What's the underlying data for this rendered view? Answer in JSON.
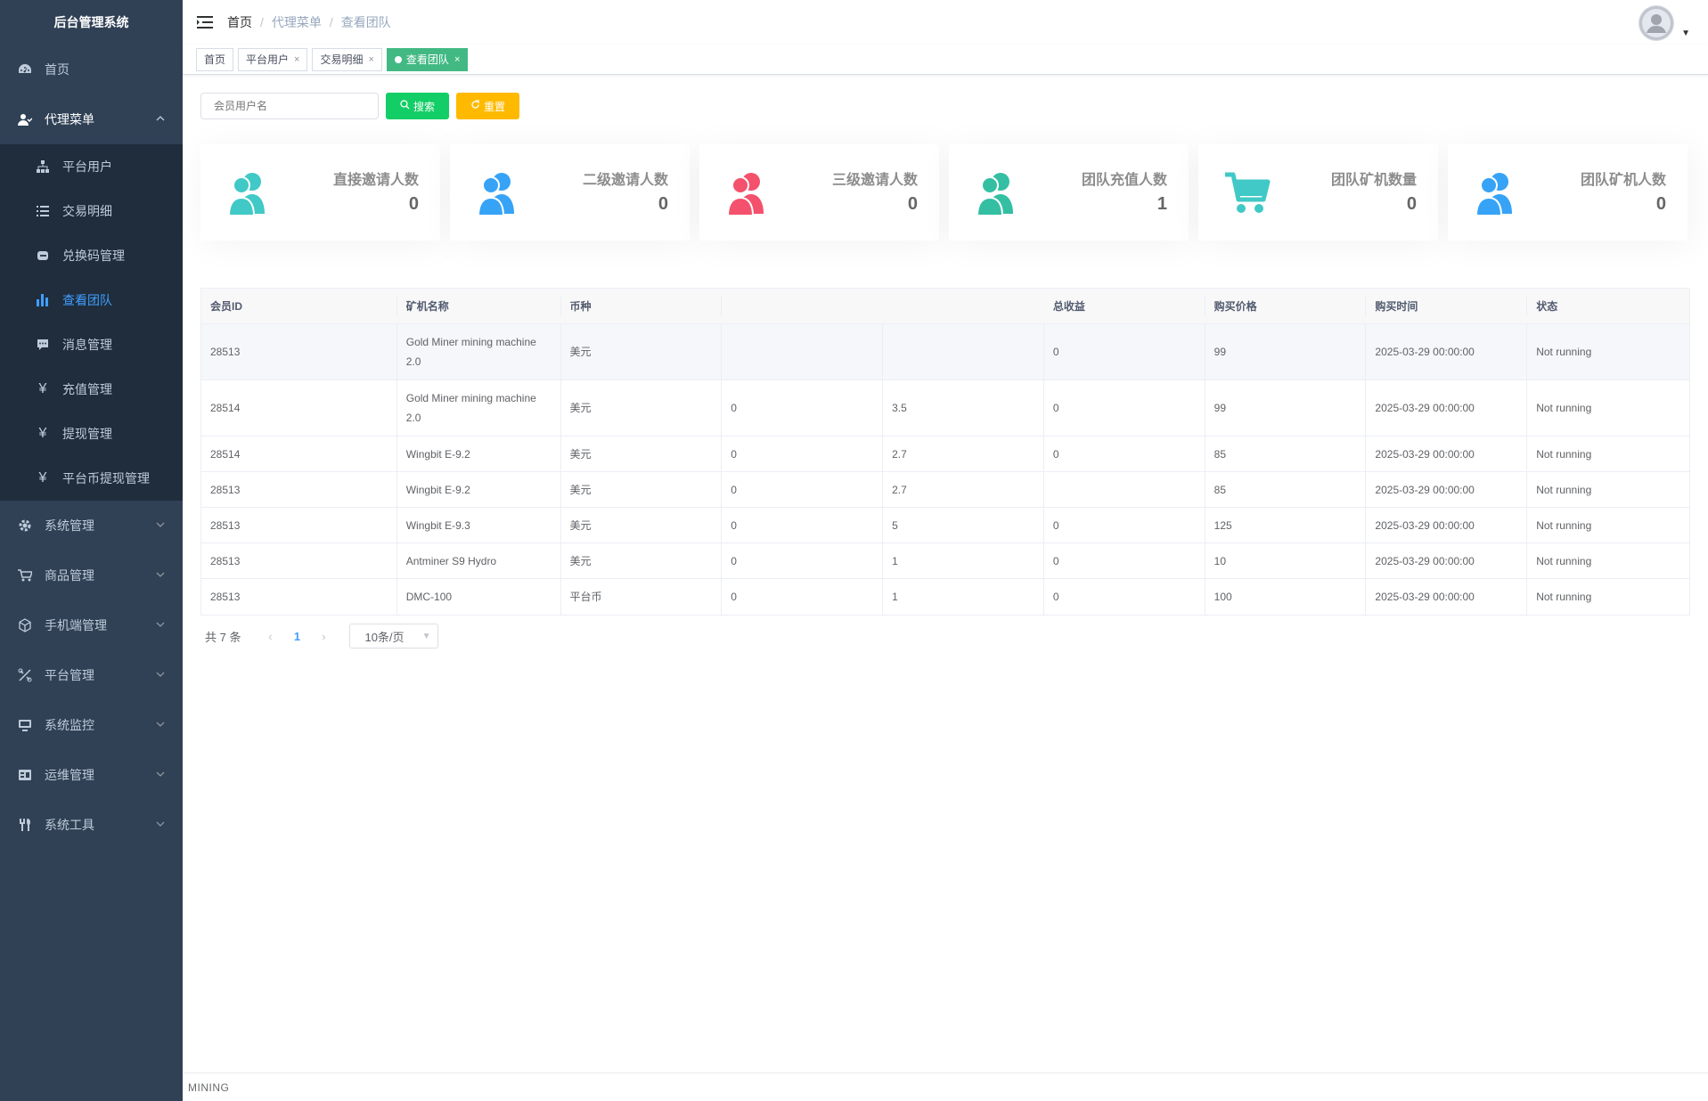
{
  "app": {
    "title": "后台管理系统"
  },
  "sidebar": {
    "items": [
      {
        "label": "首页",
        "icon": "dashboard-icon"
      },
      {
        "label": "代理菜单",
        "icon": "user-icon",
        "open": true
      },
      {
        "label": "系统管理",
        "icon": "gear-icon"
      },
      {
        "label": "商品管理",
        "icon": "cart-icon"
      },
      {
        "label": "手机端管理",
        "icon": "cube-icon"
      },
      {
        "label": "平台管理",
        "icon": "tools-icon"
      },
      {
        "label": "系统监控",
        "icon": "monitor-icon"
      },
      {
        "label": "运维管理",
        "icon": "server-icon"
      },
      {
        "label": "系统工具",
        "icon": "toolbox-icon"
      }
    ],
    "submenu": [
      {
        "label": "平台用户",
        "icon": "tree-icon"
      },
      {
        "label": "交易明细",
        "icon": "list-icon"
      },
      {
        "label": "兑换码管理",
        "icon": "code-icon"
      },
      {
        "label": "查看团队",
        "icon": "bar-chart-icon",
        "active": true
      },
      {
        "label": "消息管理",
        "icon": "message-icon"
      },
      {
        "label": "充值管理",
        "icon": "yen-icon"
      },
      {
        "label": "提现管理",
        "icon": "yen-icon"
      },
      {
        "label": "平台币提现管理",
        "icon": "yen-icon"
      }
    ]
  },
  "breadcrumb": [
    "首页",
    "代理菜单",
    "查看团队"
  ],
  "tags": [
    {
      "label": "首页",
      "closable": false
    },
    {
      "label": "平台用户",
      "closable": true
    },
    {
      "label": "交易明细",
      "closable": true
    },
    {
      "label": "查看团队",
      "closable": true,
      "active": true
    }
  ],
  "search": {
    "placeholder": "会员用户名",
    "search_label": "搜索",
    "reset_label": "重置"
  },
  "cards": [
    {
      "title": "直接邀请人数",
      "value": "0",
      "icon": "people-icon",
      "color": "#40c9c6"
    },
    {
      "title": "二级邀请人数",
      "value": "0",
      "icon": "people-icon",
      "color": "#36a3f7"
    },
    {
      "title": "三级邀请人数",
      "value": "0",
      "icon": "people-icon",
      "color": "#f4516c"
    },
    {
      "title": "团队充值人数",
      "value": "1",
      "icon": "people-icon",
      "color": "#34bfa3"
    },
    {
      "title": "团队矿机数量",
      "value": "0",
      "icon": "cart-icon",
      "color": "#40c9c6"
    },
    {
      "title": "团队矿机人数",
      "value": "0",
      "icon": "people-icon",
      "color": "#36a3f7"
    }
  ],
  "table": {
    "columns": [
      "会员ID",
      "矿机名称",
      "币种",
      "",
      "",
      "总收益",
      "购买价格",
      "购买时间",
      "状态"
    ],
    "rows": [
      [
        "28513",
        "Gold Miner mining machine 2.0",
        "美元",
        "",
        "",
        "0",
        "99",
        "2025-03-29 00:00:00",
        "Not running"
      ],
      [
        "28514",
        "Gold Miner mining machine 2.0",
        "美元",
        "0",
        "3.5",
        "0",
        "99",
        "2025-03-29 00:00:00",
        "Not running"
      ],
      [
        "28514",
        "Wingbit E-9.2",
        "美元",
        "0",
        "2.7",
        "0",
        "85",
        "2025-03-29 00:00:00",
        "Not running"
      ],
      [
        "28513",
        "Wingbit E-9.2",
        "美元",
        "0",
        "2.7",
        "",
        "85",
        "2025-03-29 00:00:00",
        "Not running"
      ],
      [
        "28513",
        "Wingbit E-9.3",
        "美元",
        "0",
        "5",
        "0",
        "125",
        "2025-03-29 00:00:00",
        "Not running"
      ],
      [
        "28513",
        "Antminer S9 Hydro",
        "美元",
        "0",
        "1",
        "0",
        "10",
        "2025-03-29 00:00:00",
        "Not running"
      ],
      [
        "28513",
        "DMC-100",
        "平台币",
        "0",
        "1",
        "0",
        "100",
        "2025-03-29 00:00:00",
        "Not running"
      ]
    ]
  },
  "pagination": {
    "total": "共 7 条",
    "page": "1",
    "page_size": "10条/页"
  },
  "footer": {
    "text": "MINING"
  }
}
